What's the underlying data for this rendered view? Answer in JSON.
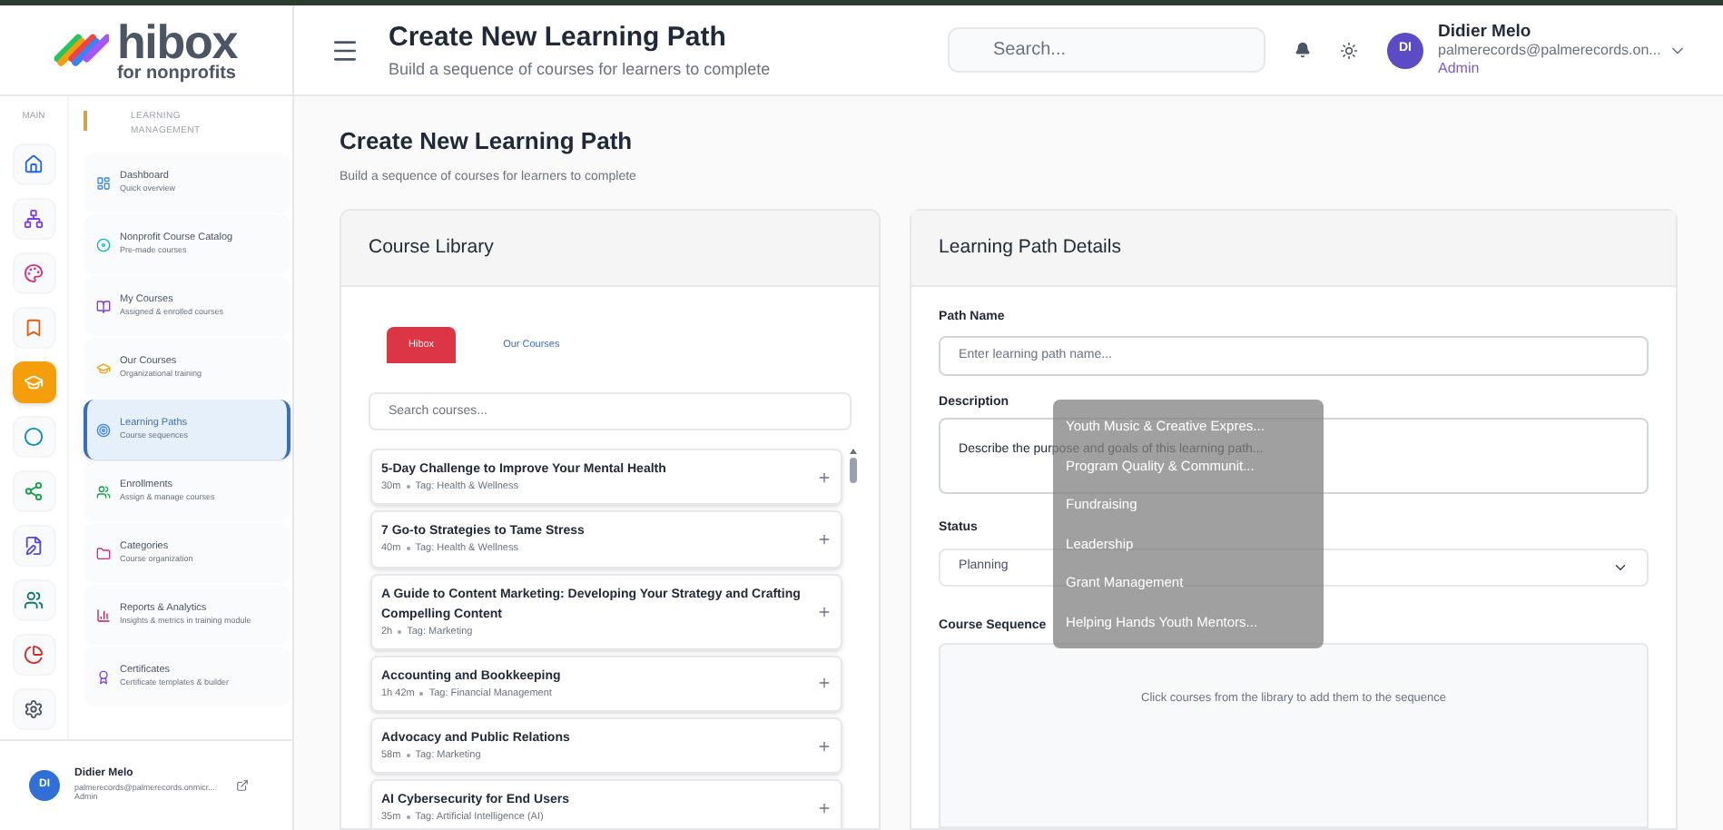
{
  "brand": {
    "name": "hibox",
    "tagline": "for nonprofits"
  },
  "header": {
    "title": "Create New Learning Path",
    "subtitle": "Build a sequence of courses for learners to complete",
    "search": {
      "placeholder": "Search..."
    },
    "user": {
      "initials": "DI",
      "name": "Didier Melo",
      "email": "palmerecords@palmerecords.on...",
      "role": "Admin"
    }
  },
  "rail": {
    "label": "MAIN",
    "items": [
      {
        "kind": "home",
        "selected": false
      },
      {
        "kind": "sitemap",
        "selected": false
      },
      {
        "kind": "swatch",
        "selected": false
      },
      {
        "kind": "bookmark",
        "selected": false
      },
      {
        "kind": "cap",
        "selected": true
      },
      {
        "kind": "dot",
        "selected": false
      },
      {
        "kind": "network",
        "selected": false
      },
      {
        "kind": "edit",
        "selected": false
      },
      {
        "kind": "users",
        "selected": false
      },
      {
        "kind": "pie",
        "selected": false
      },
      {
        "kind": "gear",
        "selected": false
      }
    ]
  },
  "nav": {
    "section": "LEARNING MANAGEMENT",
    "items": [
      {
        "title": "Dashboard",
        "subtitle": "Quick overview",
        "selected": false
      },
      {
        "title": "Nonprofit Course Catalog",
        "subtitle": "Pre-made courses",
        "selected": false
      },
      {
        "title": "My Courses",
        "subtitle": "Assigned & enrolled courses",
        "selected": false
      },
      {
        "title": "Our Courses",
        "subtitle": "Organizational training",
        "selected": false
      },
      {
        "title": "Learning Paths",
        "subtitle": "Course sequences",
        "selected": true
      },
      {
        "title": "Enrollments",
        "subtitle": "Assign & manage courses",
        "selected": false
      },
      {
        "title": "Categories",
        "subtitle": "Course organization",
        "selected": false
      },
      {
        "title": "Reports & Analytics",
        "subtitle": "Insights & metrics in training module",
        "selected": false
      },
      {
        "title": "Certificates",
        "subtitle": "Certificate templates & builder",
        "selected": false
      }
    ]
  },
  "sidebar_user": {
    "initials": "DI",
    "name": "Didier Melo",
    "email": "palmerecords@palmerecords.onmicr...",
    "role": "Admin"
  },
  "page": {
    "title": "Create New Learning Path",
    "subtitle": "Build a sequence of courses for learners to complete"
  },
  "library": {
    "title": "Course Library",
    "tabs": [
      {
        "label": "Hibox",
        "selected": true
      },
      {
        "label": "Our Courses",
        "selected": false
      }
    ],
    "search": {
      "placeholder": "Search courses..."
    },
    "courses": [
      {
        "title": "5-Day Challenge to Improve Your Mental Health",
        "duration": "30m",
        "tag": "Tag: Health & Wellness"
      },
      {
        "title": "7 Go-to Strategies to Tame Stress",
        "duration": "40m",
        "tag": "Tag: Health & Wellness"
      },
      {
        "title": "A Guide to Content Marketing: Developing Your Strategy and Crafting Compelling Content",
        "duration": "2h",
        "tag": "Tag: Marketing"
      },
      {
        "title": "Accounting and Bookkeeping",
        "duration": "1h 42m",
        "tag": "Tag: Financial Management"
      },
      {
        "title": "Advocacy and Public Relations",
        "duration": "58m",
        "tag": "Tag: Marketing"
      },
      {
        "title": "AI Cybersecurity for End Users",
        "duration": "35m",
        "tag": "Tag: Artificial Intelligence (AI)"
      }
    ]
  },
  "details": {
    "title": "Learning Path Details",
    "path_name": {
      "label": "Path Name",
      "placeholder": "Enter learning path name..."
    },
    "description": {
      "label": "Description",
      "placeholder": "Describe the purpose and goals of this learning path..."
    },
    "status": {
      "label": "Status",
      "value": "Planning"
    },
    "sequence": {
      "label": "Course Sequence",
      "empty": "Click courses from the library to add them to the sequence"
    }
  },
  "suggestions": [
    "Youth Music & Creative Expres...",
    "Program Quality & Communit...",
    "Fundraising",
    "Leadership",
    "Grant Management",
    "Helping Hands Youth Mentors..."
  ]
}
